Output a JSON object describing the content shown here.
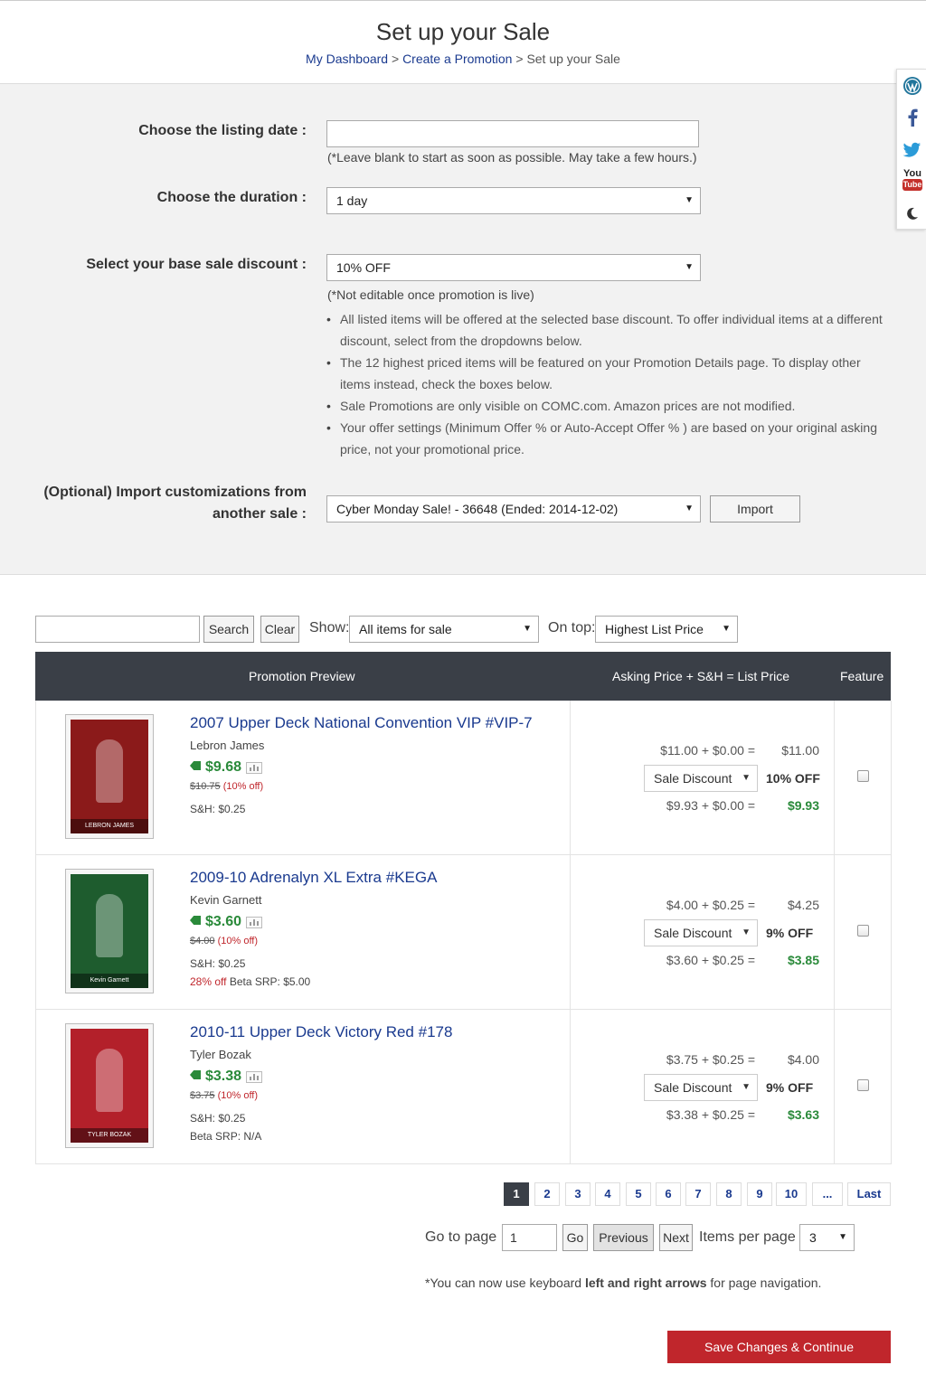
{
  "header": {
    "title": "Set up your Sale",
    "breadcrumb": {
      "dashboard": "My Dashboard",
      "sep1": ">",
      "create": "Create a Promotion",
      "sep2": ">",
      "current": "Set up your Sale"
    }
  },
  "form": {
    "listing_date_label": "Choose the listing date :",
    "listing_date_value": "",
    "listing_date_hint": "(*Leave blank to start as soon as possible. May take a few hours.)",
    "duration_label": "Choose the duration :",
    "duration_value": "1 day",
    "discount_label": "Select your base sale discount :",
    "discount_value": "10% OFF",
    "discount_hint": "(*Not editable once promotion is live)",
    "bullets": [
      "All listed items will be offered at the selected base discount. To offer individual items at a different discount, select from the dropdowns below.",
      "The 12 highest priced items will be featured on your Promotion Details page. To display other items instead, check the boxes below.",
      "Sale Promotions are only visible on COMC.com. Amazon prices are not modified.",
      "Your offer settings (Minimum Offer % or Auto-Accept Offer % ) are based on your original asking price, not your promotional price."
    ],
    "import_label_line1": "(Optional) Import customizations from",
    "import_label_line2": "another sale :",
    "import_select_value": "Cyber Monday Sale! - 36648 (Ended: 2014-12-02)",
    "import_button": "Import"
  },
  "social": [
    "wordpress-icon",
    "facebook-icon",
    "twitter-icon",
    "youtube-icon",
    "moon-icon"
  ],
  "social_labels": {
    "youtube_top": "You",
    "youtube_bottom": "Tube"
  },
  "filters": {
    "search_value": "",
    "search_button": "Search",
    "clear_button": "Clear",
    "show_label": "Show:",
    "show_value": "All items for sale",
    "ontop_label": "On top:",
    "ontop_value": "Highest List Price"
  },
  "table": {
    "headers": {
      "preview": "Promotion Preview",
      "price": "Asking Price + S&H = List Price",
      "feature": "Feature"
    },
    "rows": [
      {
        "title": "2007 Upper Deck National Convention VIP #VIP-7",
        "player": "Lebron James",
        "sale_price": "$9.68",
        "orig_price": "$10.75",
        "orig_pct": "(10% off)",
        "sh": "S&H: $0.25",
        "srp_red": "",
        "srp": "",
        "ask_line": "$11.00 + $0.00 =",
        "ask_total": "$11.00",
        "discount_select": "Sale Discount",
        "off": "10% OFF",
        "new_line": "$9.93 + $0.00 =",
        "new_total": "$9.93",
        "card_color": "#8b1a1a",
        "card_text": "LEBRON JAMES"
      },
      {
        "title": "2009-10 Adrenalyn XL Extra #KEGA",
        "player": "Kevin Garnett",
        "sale_price": "$3.60",
        "orig_price": "$4.00",
        "orig_pct": "(10% off)",
        "sh": "S&H: $0.25",
        "srp_red": "28% off",
        "srp": "Beta SRP: $5.00",
        "ask_line": "$4.00 + $0.25 =",
        "ask_total": "$4.25",
        "discount_select": "Sale Discount",
        "off": "9% OFF",
        "new_line": "$3.60 + $0.25 =",
        "new_total": "$3.85",
        "card_color": "#1e5c2e",
        "card_text": "Kevin Garnett"
      },
      {
        "title": "2010-11 Upper Deck Victory Red #178",
        "player": "Tyler Bozak",
        "sale_price": "$3.38",
        "orig_price": "$3.75",
        "orig_pct": "(10% off)",
        "sh": "S&H: $0.25",
        "srp_red": "",
        "srp": "Beta SRP: N/A",
        "ask_line": "$3.75 + $0.25 =",
        "ask_total": "$4.00",
        "discount_select": "Sale Discount",
        "off": "9% OFF",
        "new_line": "$3.38 + $0.25 =",
        "new_total": "$3.63",
        "card_color": "#b3202a",
        "card_text": "TYLER BOZAK"
      }
    ]
  },
  "pagination": {
    "pages": [
      "1",
      "2",
      "3",
      "4",
      "5",
      "6",
      "7",
      "8",
      "9",
      "10",
      "...",
      "Last"
    ],
    "active": "1",
    "goto_label": "Go to page",
    "goto_value": "1",
    "go_button": "Go",
    "previous_button": "Previous",
    "next_button": "Next",
    "items_per_page_label": "Items per page",
    "items_per_page_value": "3"
  },
  "note": {
    "prefix": "*You can now use keyboard ",
    "bold": "left and right arrows",
    "suffix": " for page navigation."
  },
  "save_button": "Save Changes & Continue"
}
